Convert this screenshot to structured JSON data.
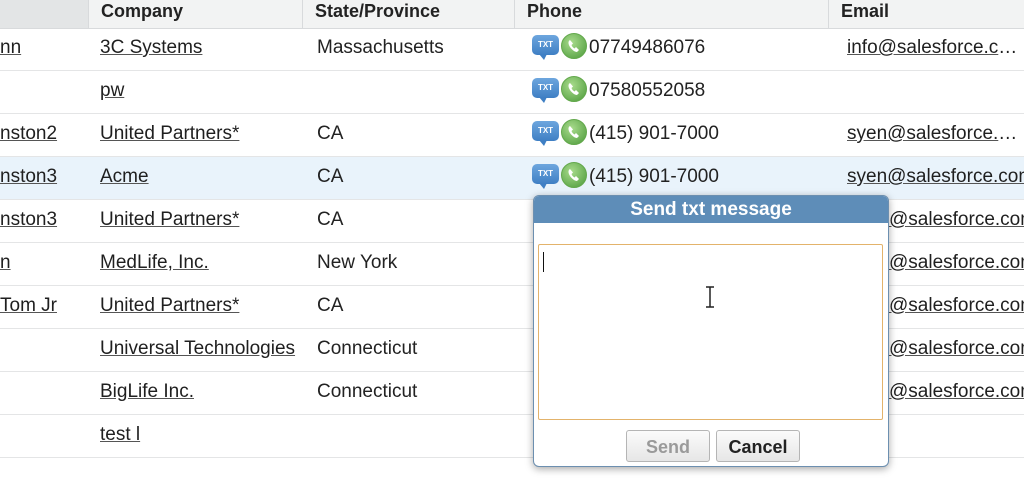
{
  "columns": [
    "",
    "Company",
    "State/Province",
    "Phone",
    "Email"
  ],
  "rows": [
    {
      "name": "nn",
      "company": "3C Systems",
      "state": "Massachusetts",
      "phone": "07749486076",
      "email": "info@salesforce.com"
    },
    {
      "name": "",
      "company": "pw",
      "state": "",
      "phone": "07580552058",
      "email": ""
    },
    {
      "name": "nston2",
      "company": "United Partners*",
      "state": "CA",
      "phone": "(415) 901-7000",
      "email": "syen@salesforce.com"
    },
    {
      "name": "nston3",
      "company": "Acme",
      "state": "CA",
      "phone": "(415) 901-7000",
      "email": "syen@salesforce.com"
    },
    {
      "name": "nston3",
      "company": "United Partners*",
      "state": "CA",
      "phone": "",
      "email": "@salesforce.com"
    },
    {
      "name": "n",
      "company": "MedLife, Inc.",
      "state": "New York",
      "phone": "",
      "email": "@salesforce.com"
    },
    {
      "name": "Tom Jr",
      "company": "United Partners*",
      "state": "CA",
      "phone": "",
      "email": "@salesforce.com"
    },
    {
      "name": "",
      "company": "Universal Technologies",
      "state": "Connecticut",
      "phone": "",
      "email": "@salesforce.com"
    },
    {
      "name": "",
      "company": "BigLife Inc.",
      "state": "Connecticut",
      "phone": "",
      "email": "@salesforce.com"
    },
    {
      "name": "",
      "company": "test l",
      "state": "",
      "phone": "",
      "email": ""
    }
  ],
  "icons": {
    "sms": "sms-bubble-icon",
    "call": "phone-call-icon",
    "sms_label": "TXT"
  },
  "dialog": {
    "title": "Send txt message",
    "message_value": "",
    "send_label": "Send",
    "cancel_label": "Cancel"
  },
  "colors": {
    "dialog_header": "#5e8db8",
    "highlight_row": "#e9f3fb",
    "textarea_focus_border": "#e3b36b"
  }
}
